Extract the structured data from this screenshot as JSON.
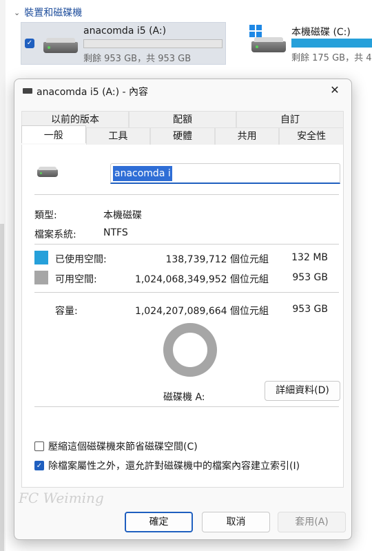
{
  "explorer": {
    "section_header": "裝置和磁碟機",
    "drives": [
      {
        "name": "anacomda i5 (A:)",
        "info": "剩餘 953 GB，共 953 GB",
        "used_fraction": 0.0,
        "selected": true
      },
      {
        "name": "本機磁碟 (C:)",
        "info": "剩餘 175 GB，共 4",
        "used_fraction": 1.0,
        "selected": false
      }
    ]
  },
  "dialog": {
    "title": "anacomda i5 (A:) - 內容",
    "tabs_row1": [
      "以前的版本",
      "配額",
      "自訂"
    ],
    "tabs_row2": [
      "一般",
      "工具",
      "硬體",
      "共用",
      "安全性"
    ],
    "active_tab": "一般",
    "name_value": "anacomda i5",
    "type_label": "類型:",
    "type_value": "本機磁碟",
    "fs_label": "檔案系統:",
    "fs_value": "NTFS",
    "used_label": "已使用空間:",
    "used_bytes": "138,739,712 個位元組",
    "used_size": "132 MB",
    "free_label": "可用空間:",
    "free_bytes": "1,024,068,349,952 個位元組",
    "free_size": "953 GB",
    "capacity_label": "容量:",
    "capacity_bytes": "1,024,207,089,664 個位元組",
    "capacity_size": "953 GB",
    "drive_label": "磁碟機 A:",
    "details_button": "詳細資料(D)",
    "compress_label": "壓縮這個磁碟機來節省磁碟空間(C)",
    "compress_checked": false,
    "index_label": "除檔案屬性之外，還允許對磁碟機中的檔案內容建立索引(I)",
    "index_checked": true,
    "ok_button": "確定",
    "cancel_button": "取消",
    "apply_button": "套用(A)",
    "watermark": "FC Weiming"
  },
  "colors": {
    "used": "#26a0da",
    "free": "#a6a6a6",
    "accent": "#1f5fbf"
  }
}
